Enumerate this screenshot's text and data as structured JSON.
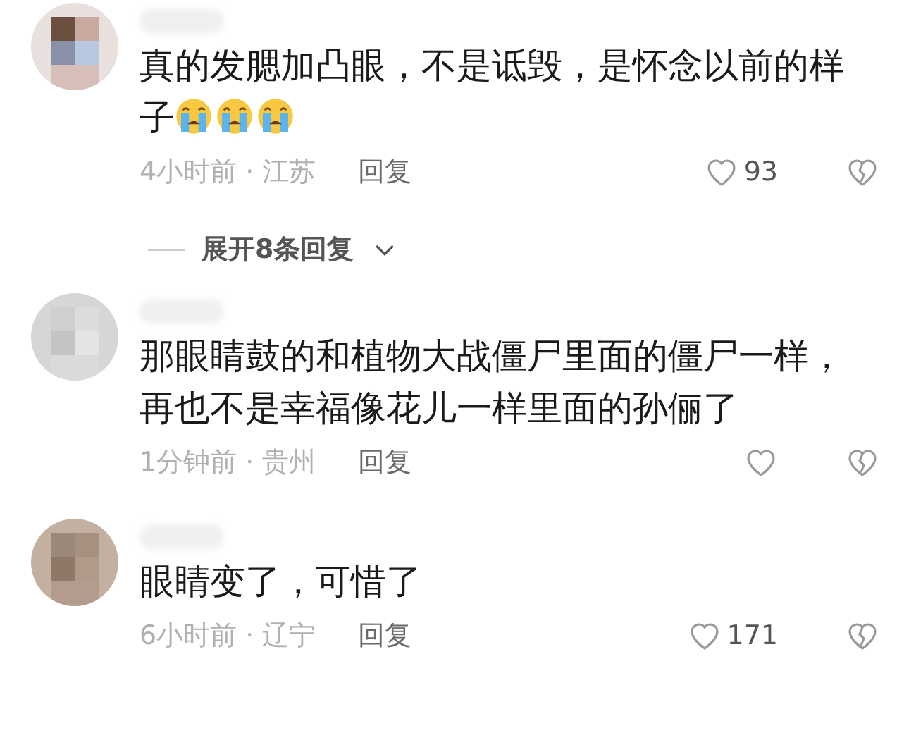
{
  "comments": [
    {
      "text": "真的发腮加凸眼，不是诋毁，是怀念以前的样子",
      "emojis": [
        {
          "kind": "crying"
        },
        {
          "kind": "crying"
        },
        {
          "kind": "crying"
        }
      ],
      "meta": "4小时前 · 江苏",
      "reply": "回复",
      "likes": "93",
      "replies_toggle": "展开8条回复"
    },
    {
      "text": "那眼睛鼓的和植物大战僵尸里面的僵尸一样，再也不是幸福像花儿一样里面的孙俪了",
      "meta": "1分钟前 · 贵州",
      "reply": "回复"
    },
    {
      "text": "眼睛变了，可惜了",
      "meta": "6小时前 · 辽宁",
      "reply": "回复",
      "likes": "171"
    }
  ]
}
